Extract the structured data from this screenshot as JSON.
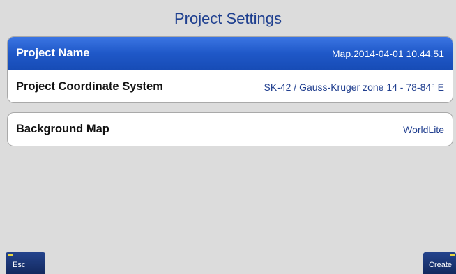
{
  "header": {
    "title": "Project Settings"
  },
  "settings": {
    "rows": [
      {
        "label": "Project Name",
        "value": "Map.2014-04-01 10.44.51",
        "selected": true
      },
      {
        "label": "Project Coordinate System",
        "value": "SK-42 / Gauss-Kruger zone 14 - 78-84° E",
        "selected": false
      },
      {
        "label": "Background Map",
        "value": "WorldLite",
        "selected": false
      }
    ]
  },
  "softkeys": {
    "left_label": "Esc",
    "right_label": "Create"
  },
  "colors": {
    "selected_row": "#1f58c8",
    "title_text": "#1e3f8f",
    "value_text": "#213f8f",
    "softkey": "#1c3677",
    "softkey_mark": "#e9d640",
    "background": "#dcdcdc"
  }
}
